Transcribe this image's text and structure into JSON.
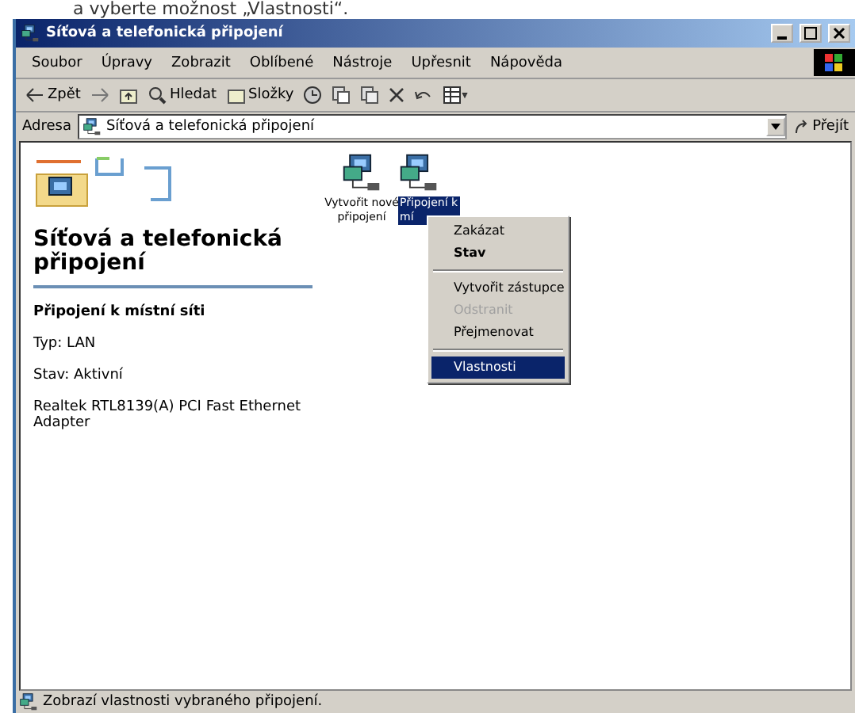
{
  "caption": "a vyberte možnost „Vlastnosti“.",
  "window": {
    "title": "Síťová a telefonická připojení"
  },
  "menu_bar": [
    "Soubor",
    "Úpravy",
    "Zobrazit",
    "Oblíbené",
    "Nástroje",
    "Upřesnit",
    "Nápověda"
  ],
  "toolbar": {
    "back": "Zpět",
    "search": "Hledat",
    "folders": "Složky"
  },
  "address_bar": {
    "label": "Adresa",
    "value": "Síťová a telefonická připojení",
    "go": "Přejít"
  },
  "left_panel": {
    "heading": "Síťová a telefonická připojení",
    "item_title": "Připojení k místní síti",
    "details": [
      "Typ: LAN",
      "Stav: Aktivní",
      "Realtek RTL8139(A) PCI Fast Ethernet Adapter"
    ]
  },
  "icons": [
    {
      "label_lines": [
        "Vytvořit nové",
        "připojení"
      ],
      "selected": false
    },
    {
      "label_lines": [
        "Připojení k",
        "mí"
      ],
      "selected": true
    }
  ],
  "context_menu": [
    {
      "kind": "item",
      "label": "Zakázat",
      "bold": false,
      "disabled": false,
      "selected": false
    },
    {
      "kind": "item",
      "label": "Stav",
      "bold": true,
      "disabled": false,
      "selected": false
    },
    {
      "kind": "separator"
    },
    {
      "kind": "item",
      "label": "Vytvořit zástupce",
      "bold": false,
      "disabled": false,
      "selected": false
    },
    {
      "kind": "item",
      "label": "Odstranit",
      "bold": false,
      "disabled": true,
      "selected": false
    },
    {
      "kind": "item",
      "label": "Přejmenovat",
      "bold": false,
      "disabled": false,
      "selected": false
    },
    {
      "kind": "separator"
    },
    {
      "kind": "item",
      "label": "Vlastnosti",
      "bold": false,
      "disabled": false,
      "selected": true
    }
  ],
  "status_bar": "Zobrazí vlastnosti vybraného připojení."
}
